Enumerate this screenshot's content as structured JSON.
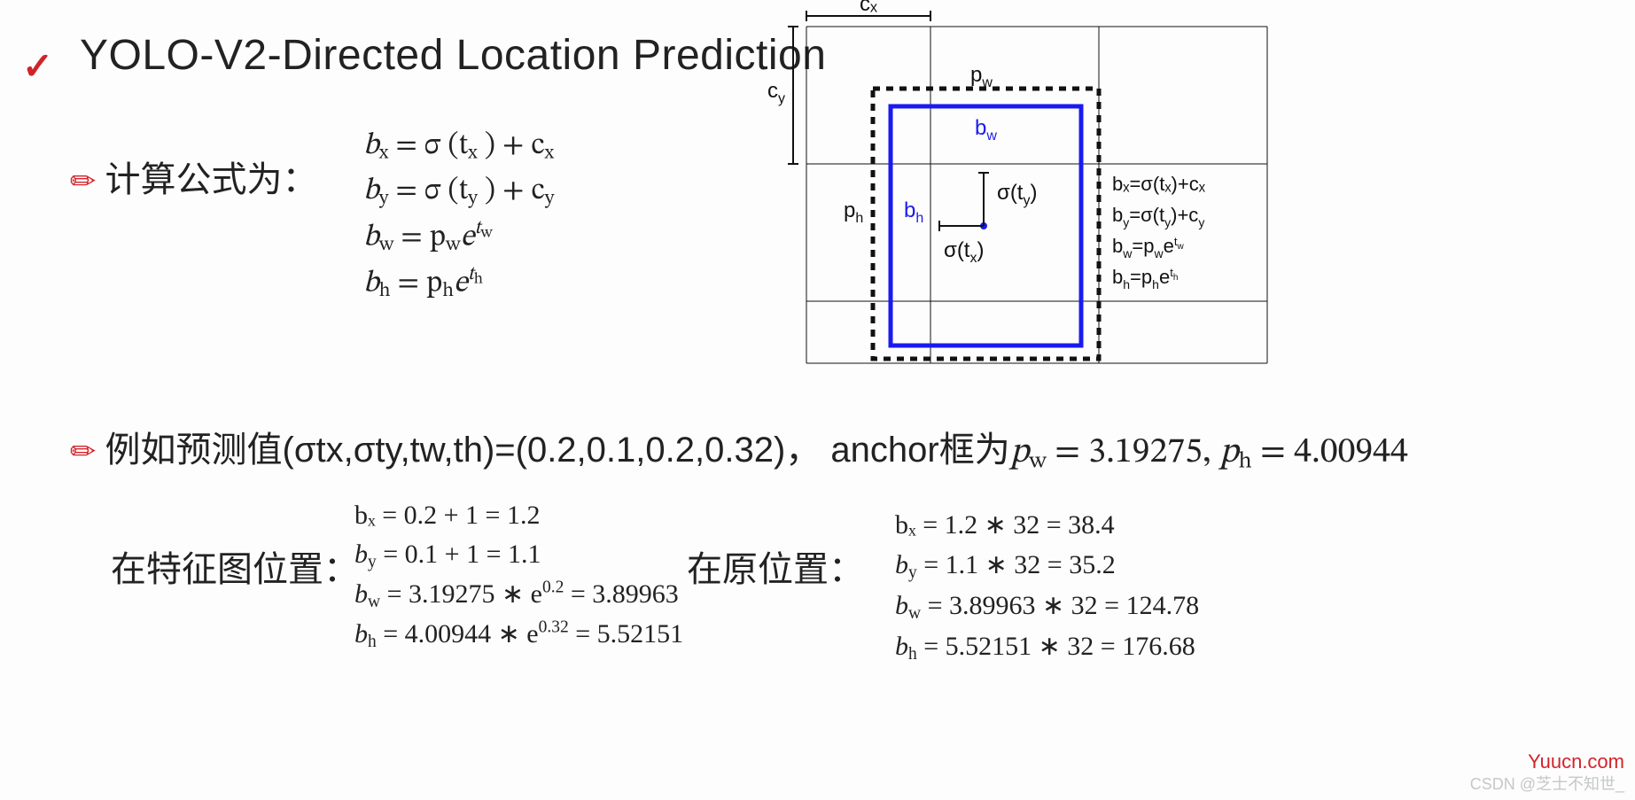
{
  "title": "YOLO-V2-Directed Location Prediction",
  "section1_label": "计算公式为：",
  "formulas_main": {
    "r1_left": "b",
    "r1_sub": "x",
    "r1_mid": " = σ (t",
    "r1_sub2": "x",
    "r1_mid2": " ) + c",
    "r1_sub3": "x",
    "r2_left": "b",
    "r2_sub": "y",
    "r2_mid": " = σ (t",
    "r2_sub2": "y",
    "r2_mid2": " ) + c",
    "r2_sub3": "y",
    "r3_left": "b",
    "r3_sub": "w",
    "r3_mid": " = p",
    "r3_sub2": "w",
    "r3_e": "e",
    "r3_sup": "t",
    "r3_supsub": "w",
    "r4_left": "b",
    "r4_sub": "h",
    "r4_mid": " = p",
    "r4_sub2": "h",
    "r4_e": "e",
    "r4_sup": "t",
    "r4_supsub": "h"
  },
  "example_line": {
    "pre": "例如预测值(σtx,σty,tw,th)=(0.2,0.1,0.2,0.32)，  anchor框为",
    "pw_l": "p",
    "pw_s": "w",
    "pw_eq": " = 3.19275, ",
    "ph_l": "p",
    "ph_s": "h",
    "ph_eq": " = 4.00944"
  },
  "feat_label": "在特征图位置：",
  "feat_block": {
    "r1": "bₓ = 0.2 + 1 = 1.2",
    "r2_a": "b",
    "r2_s": "y",
    "r2_b": " = 0.1 + 1 = 1.1",
    "r3_a": "b",
    "r3_s": "w",
    "r3_b": " = 3.19275 ∗ e",
    "r3_sup": "0.2",
    "r3_c": " = 3.89963",
    "r4_a": "b",
    "r4_s": "h",
    "r4_b": " = 4.00944 ∗ e",
    "r4_sup": "0.32",
    "r4_c": " = 5.52151"
  },
  "orig_label": "在原位置：",
  "orig_block": {
    "r1": "bₓ = 1.2 ∗ 32 = 38.4",
    "r2_a": "b",
    "r2_s": "y",
    "r2_b": " = 1.1 ∗ 32 = 35.2",
    "r3_a": "b",
    "r3_s": "w",
    "r3_b": " = 3.89963 ∗ 32 = 124.78",
    "r4_a": "b",
    "r4_s": "h",
    "r4_b": " = 5.52151 ∗ 32 = 176.68"
  },
  "diagram": {
    "cx": "cₓ",
    "cy": "c",
    "cy_sub": "y",
    "pw": "p",
    "pw_sub": "w",
    "ph": "p",
    "ph_sub": "h",
    "bw": "b",
    "bw_sub": "w",
    "bh": "b",
    "bh_sub": "h",
    "sty": "σ(t",
    "sty_sub": "y",
    "sty_end": ")",
    "stx": "σ(t",
    "stx_sub": "x",
    "stx_end": ")",
    "eq1": "bₓ=σ(tₓ)+cₓ",
    "eq2_a": "b",
    "eq2_s": "y",
    "eq2_b": "=σ(t",
    "eq2_s2": "y",
    "eq2_c": ")+c",
    "eq2_s3": "y",
    "eq3_a": "b",
    "eq3_s": "w",
    "eq3_b": "=p",
    "eq3_s2": "w",
    "eq3_c": "e",
    "eq3_sup": "t",
    "eq3_sups": "w",
    "eq4_a": "b",
    "eq4_s": "h",
    "eq4_b": "=p",
    "eq4_s2": "h",
    "eq4_c": "e",
    "eq4_sup": "t",
    "eq4_sups": "h"
  },
  "watermark_red": "Yuucn.com",
  "watermark_grey": "CSDN @芝士不知世_"
}
